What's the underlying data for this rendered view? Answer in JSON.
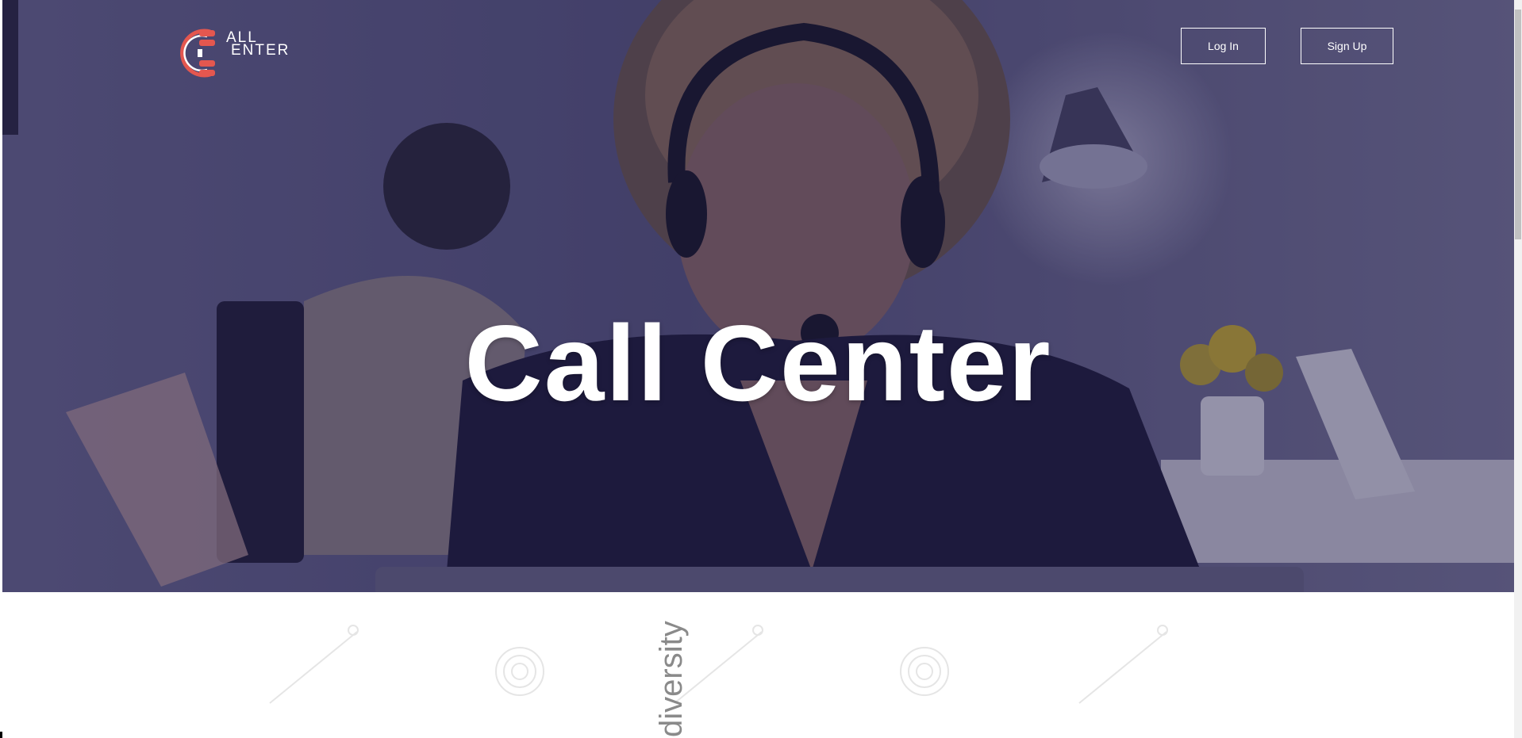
{
  "brand": {
    "logo_line1": "ALL",
    "logo_line2": "ENTER",
    "logo_initial": "C",
    "accent_color": "#e4574f"
  },
  "header": {
    "login_label": "Log In",
    "signup_label": "Sign Up"
  },
  "hero": {
    "title": "Call Center",
    "overlay_color": "#2a2758"
  },
  "gallery": {
    "vertical_word": "diversity"
  }
}
